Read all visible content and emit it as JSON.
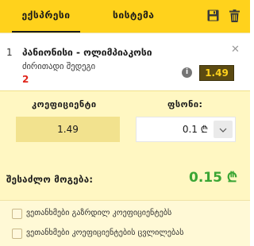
{
  "tabs": {
    "express_label": "ექსპრესი",
    "system_label": "სისტემა"
  },
  "selection": {
    "index": "1",
    "event": "პანიონისი - ოლიმპიაკოსი",
    "market": "ძირითადი შედეგი",
    "outcome": "2",
    "info_symbol": "i",
    "close_symbol": "✕",
    "odds": "1.49"
  },
  "calc": {
    "coef_label": "კოეფიციენტი",
    "stake_label": "ფსონი:",
    "coef_value": "1.49",
    "stake_value": "0.1 ₾"
  },
  "win": {
    "label": "შესაძლო მოგება:",
    "amount": "0.15 ₾"
  },
  "options": [
    {
      "label": "ვეთანხმები გაზრდილ კოეფიციენტებს"
    },
    {
      "label": "ვეთანხმები კოეფიციენტების ცვლილებას"
    }
  ],
  "colors": {
    "header_bg": "#ffd21c",
    "calc_bg": "#fff7c2",
    "win_amount": "#3aa534",
    "outcome": "#e0251b",
    "odds_bg": "#5b4a12"
  }
}
